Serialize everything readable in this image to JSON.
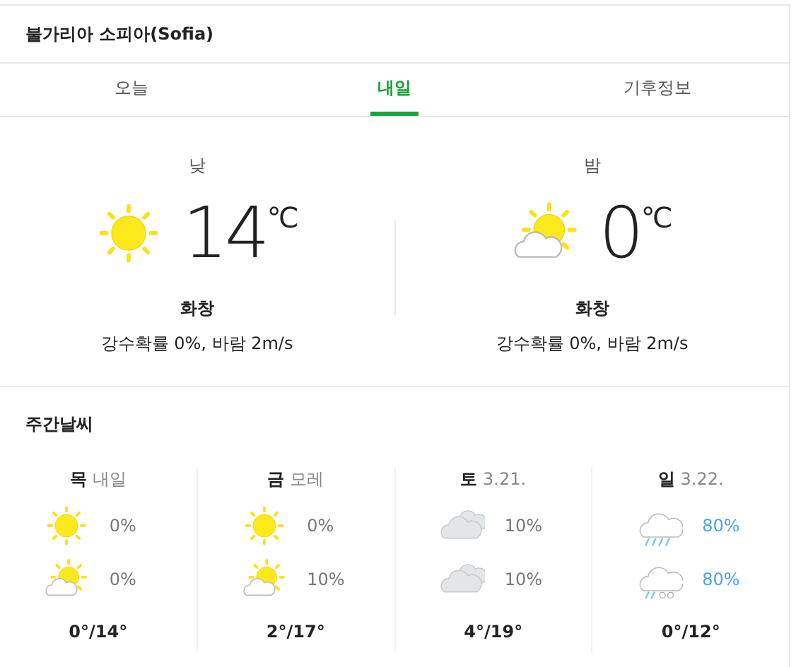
{
  "location": "불가리아 소피아(Sofia)",
  "tabs": [
    {
      "label": "오늘",
      "selected": false
    },
    {
      "label": "내일",
      "selected": true
    },
    {
      "label": "기후정보",
      "selected": false
    }
  ],
  "current": [
    {
      "period": "낮",
      "kind": "sun",
      "temp": "14",
      "unit": "℃",
      "condition": "화창",
      "details": "강수확률 0%, 바람 2m/s"
    },
    {
      "period": "밤",
      "kind": "suncloud",
      "temp": "0",
      "unit": "℃",
      "condition": "화창",
      "details": "강수확률 0%, 바람 2m/s"
    }
  ],
  "weekly": {
    "title": "주간날씨",
    "days": [
      {
        "day": "목",
        "date": "내일",
        "slots": [
          {
            "kind": "sun",
            "chance": "0%",
            "wet": false
          },
          {
            "kind": "suncloud",
            "chance": "0%",
            "wet": false
          }
        ],
        "temps": "0°/14°"
      },
      {
        "day": "금",
        "date": "모레",
        "slots": [
          {
            "kind": "sun",
            "chance": "0%",
            "wet": false
          },
          {
            "kind": "suncloud",
            "chance": "10%",
            "wet": false
          }
        ],
        "temps": "2°/17°"
      },
      {
        "day": "토",
        "date": "3.21.",
        "slots": [
          {
            "kind": "cloud",
            "chance": "10%",
            "wet": false
          },
          {
            "kind": "cloud",
            "chance": "10%",
            "wet": false
          }
        ],
        "temps": "4°/19°"
      },
      {
        "day": "일",
        "date": "3.22.",
        "slots": [
          {
            "kind": "rain",
            "chance": "80%",
            "wet": true
          },
          {
            "kind": "sleet",
            "chance": "80%",
            "wet": true
          }
        ],
        "temps": "0°/12°"
      }
    ]
  }
}
